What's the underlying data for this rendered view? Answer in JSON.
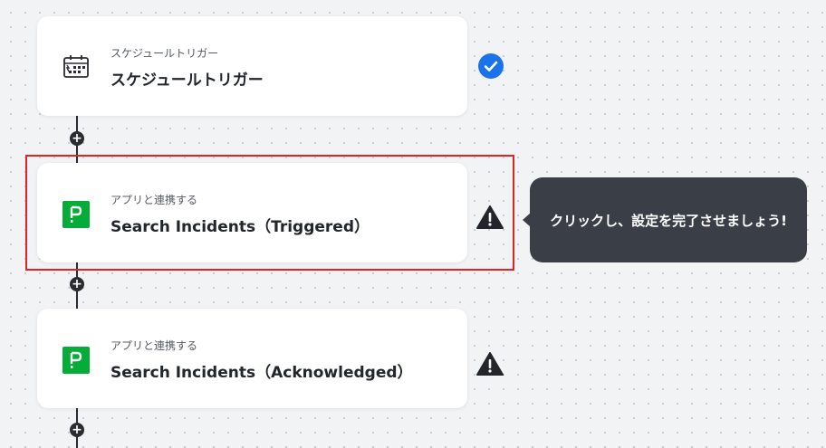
{
  "steps": [
    {
      "subtitle": "スケジュールトリガー",
      "title": "スケジュールトリガー",
      "icon": "calendar-clock-icon",
      "status": "check"
    },
    {
      "subtitle": "アプリと連携する",
      "title": "Search Incidents（Triggered）",
      "icon": "pagerduty-icon",
      "status": "warning"
    },
    {
      "subtitle": "アプリと連携する",
      "title": "Search Incidents（Acknowledged）",
      "icon": "pagerduty-icon",
      "status": "warning"
    }
  ],
  "tooltip": {
    "text": "クリックし、設定を完了させましょう!"
  },
  "colors": {
    "check_blue": "#1a73e8",
    "pagerduty_green": "#06ac38",
    "highlight_red": "#e02424",
    "tooltip_bg": "#3a3f47"
  }
}
